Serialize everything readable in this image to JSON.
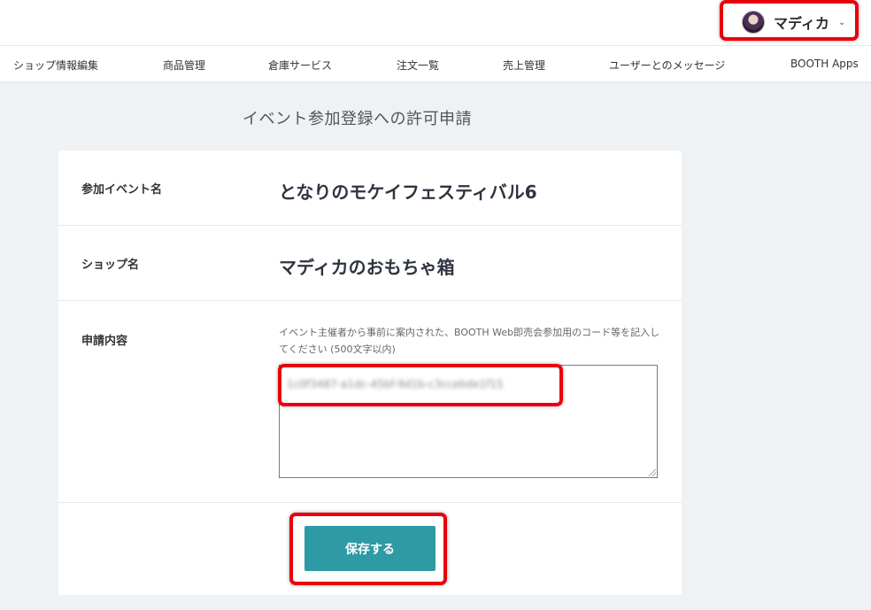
{
  "header": {
    "user_name": "マディカ",
    "avatar_icon": "avatar-image",
    "chevron_icon": "chevron-down-icon"
  },
  "nav": {
    "items": [
      "ショップ情報編集",
      "商品管理",
      "倉庫サービス",
      "注文一覧",
      "売上管理",
      "ユーザーとのメッセージ",
      "BOOTH Apps"
    ]
  },
  "page": {
    "title": "イベント参加登録への許可申請"
  },
  "form": {
    "event_label": "参加イベント名",
    "event_value": "となりのモケイフェスティバル6",
    "shop_label": "ショップ名",
    "shop_value": "マディカのおもちゃ箱",
    "request_label": "申請内容",
    "request_help": "イベント主催者から事前に案内された、BOOTH Web即売会参加用のコード等を記入してください (500文字以内)",
    "request_value": "1c0f3487-a1dc-45bf-9d1b-c3ccebde1f15"
  },
  "actions": {
    "save_label": "保存する"
  },
  "colors": {
    "accent": "#2e9aa4",
    "highlight": "#e8000c",
    "background": "#eef2f5"
  }
}
